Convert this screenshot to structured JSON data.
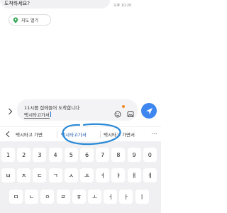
{
  "chat": {
    "prev_message": "도착하세요?",
    "time": "오후 10:20",
    "map_button": {
      "label": "지도 열기",
      "icon": "map-pin-icon"
    }
  },
  "input": {
    "line1": "11시쯤 집에들어 도착합니다",
    "line2": "택시타고가서",
    "icons": {
      "expand": "chevron-right-icon",
      "emoji": "emoji-icon",
      "gallery": "gallery-icon",
      "send": "send-icon"
    }
  },
  "suggestions": {
    "back_icon": "chevron-left-icon",
    "items": [
      "택시타고 가면",
      "택시타고가서",
      "택시타고 가면서"
    ],
    "more": "..."
  },
  "keyboard": {
    "row1": [
      "1",
      "2",
      "3",
      "4",
      "5",
      "6",
      "7",
      "8",
      "9",
      "0"
    ],
    "row2": [
      "ㅂ",
      "ㅈ",
      "ㄷ",
      "ㄱ",
      "ㅅ",
      "ㅛ",
      "ㅕ",
      "ㅑ",
      "ㅐ",
      "ㅔ"
    ],
    "row3": [
      "ㅁ",
      "ㄴ",
      "ㅇ",
      "ㄹ",
      "ㅎ",
      "ㅗ",
      "ㅓ",
      "ㅏ",
      "ㅣ"
    ]
  },
  "colors": {
    "accent": "#3e86f0",
    "annotation": "#2a8ad8",
    "notification": "#f08a24"
  }
}
